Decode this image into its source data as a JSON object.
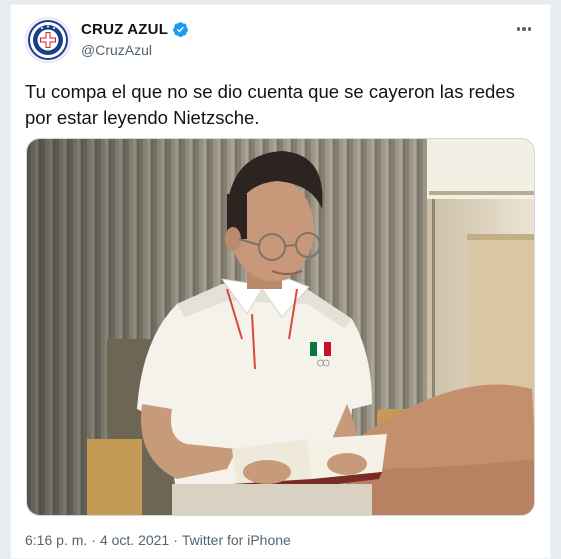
{
  "tweet": {
    "display_name": "CRUZ AZUL",
    "handle": "@CruzAzul",
    "verified": true,
    "text": "Tu compa el que no se dio cuenta que se cayeron las redes por estar leyendo Nietzsche.",
    "time": "6:16 p. m.",
    "separator": "·",
    "date": "4 oct. 2021",
    "source": "Twitter for iPhone"
  },
  "icons": {
    "verified": "verified-badge-icon",
    "more": "more-options-icon",
    "avatar": "cruz-azul-crest-logo"
  },
  "colors": {
    "verified_blue": "#1d9bf0",
    "brand_blue": "#1a3d8f",
    "secondary_text": "#536471"
  }
}
